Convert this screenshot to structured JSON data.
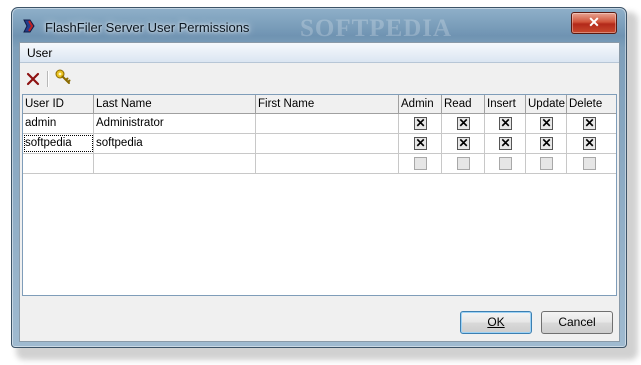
{
  "window": {
    "title": "FlashFiler Server User Permissions",
    "watermark": "SOFTPEDIA",
    "close_label": "✕"
  },
  "menu": {
    "user": "User"
  },
  "toolbar": {
    "delete_icon": "delete-icon",
    "key_icon": "key-icon"
  },
  "grid": {
    "columns": [
      "User ID",
      "Last Name",
      "First Name",
      "Admin",
      "Read",
      "Insert",
      "Update",
      "Delete"
    ],
    "rows": [
      {
        "user_id": "admin",
        "last_name": "Administrator",
        "first_name": "",
        "admin": true,
        "read": true,
        "insert": true,
        "update": true,
        "delete": true
      },
      {
        "user_id": "softpedia",
        "last_name": "softpedia",
        "first_name": "",
        "admin": true,
        "read": true,
        "insert": true,
        "update": true,
        "delete": true
      },
      {
        "user_id": "",
        "last_name": "",
        "first_name": "",
        "admin": false,
        "read": false,
        "insert": false,
        "update": false,
        "delete": false
      }
    ]
  },
  "buttons": {
    "ok_label": "OK",
    "cancel_label": "Cancel"
  }
}
